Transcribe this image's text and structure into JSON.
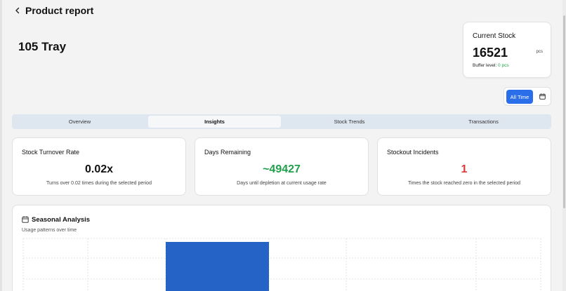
{
  "header": {
    "title": "Product report"
  },
  "product": {
    "name": "105 Tray"
  },
  "current_stock": {
    "label": "Current Stock",
    "value": "16521",
    "unit": "pcs",
    "buffer_label": "Buffer level:",
    "buffer_value": "0 pcs",
    "buffer_color": "#1faa4a"
  },
  "filter": {
    "all_time_label": "All Time",
    "calendar_icon": "calendar-icon",
    "accent": "#2a6ee9"
  },
  "tabs": [
    {
      "label": "Overview",
      "active": false
    },
    {
      "label": "Insights",
      "active": true
    },
    {
      "label": "Stock Trends",
      "active": false
    },
    {
      "label": "Transactions",
      "active": false
    }
  ],
  "metrics": [
    {
      "title": "Stock Turnover Rate",
      "value": "0.02x",
      "desc": "Turns over 0.02 times during the selected period",
      "color": "#111111"
    },
    {
      "title": "Days Remaining",
      "value": "~49427",
      "desc": "Days until depletion at current usage rate",
      "color": "#1fa04a"
    },
    {
      "title": "Stockout Incidents",
      "value": "1",
      "desc": "Times the stock reached zero in the selected period",
      "color": "#d93a3a"
    }
  ],
  "seasonal": {
    "title": "Seasonal Analysis",
    "subtitle": "Usage patterns over time",
    "icon": "calendar-icon"
  },
  "chart_data": {
    "type": "bar",
    "bar_color": "#2563c7",
    "grid": true,
    "bars": [
      {
        "value": 1
      }
    ]
  }
}
